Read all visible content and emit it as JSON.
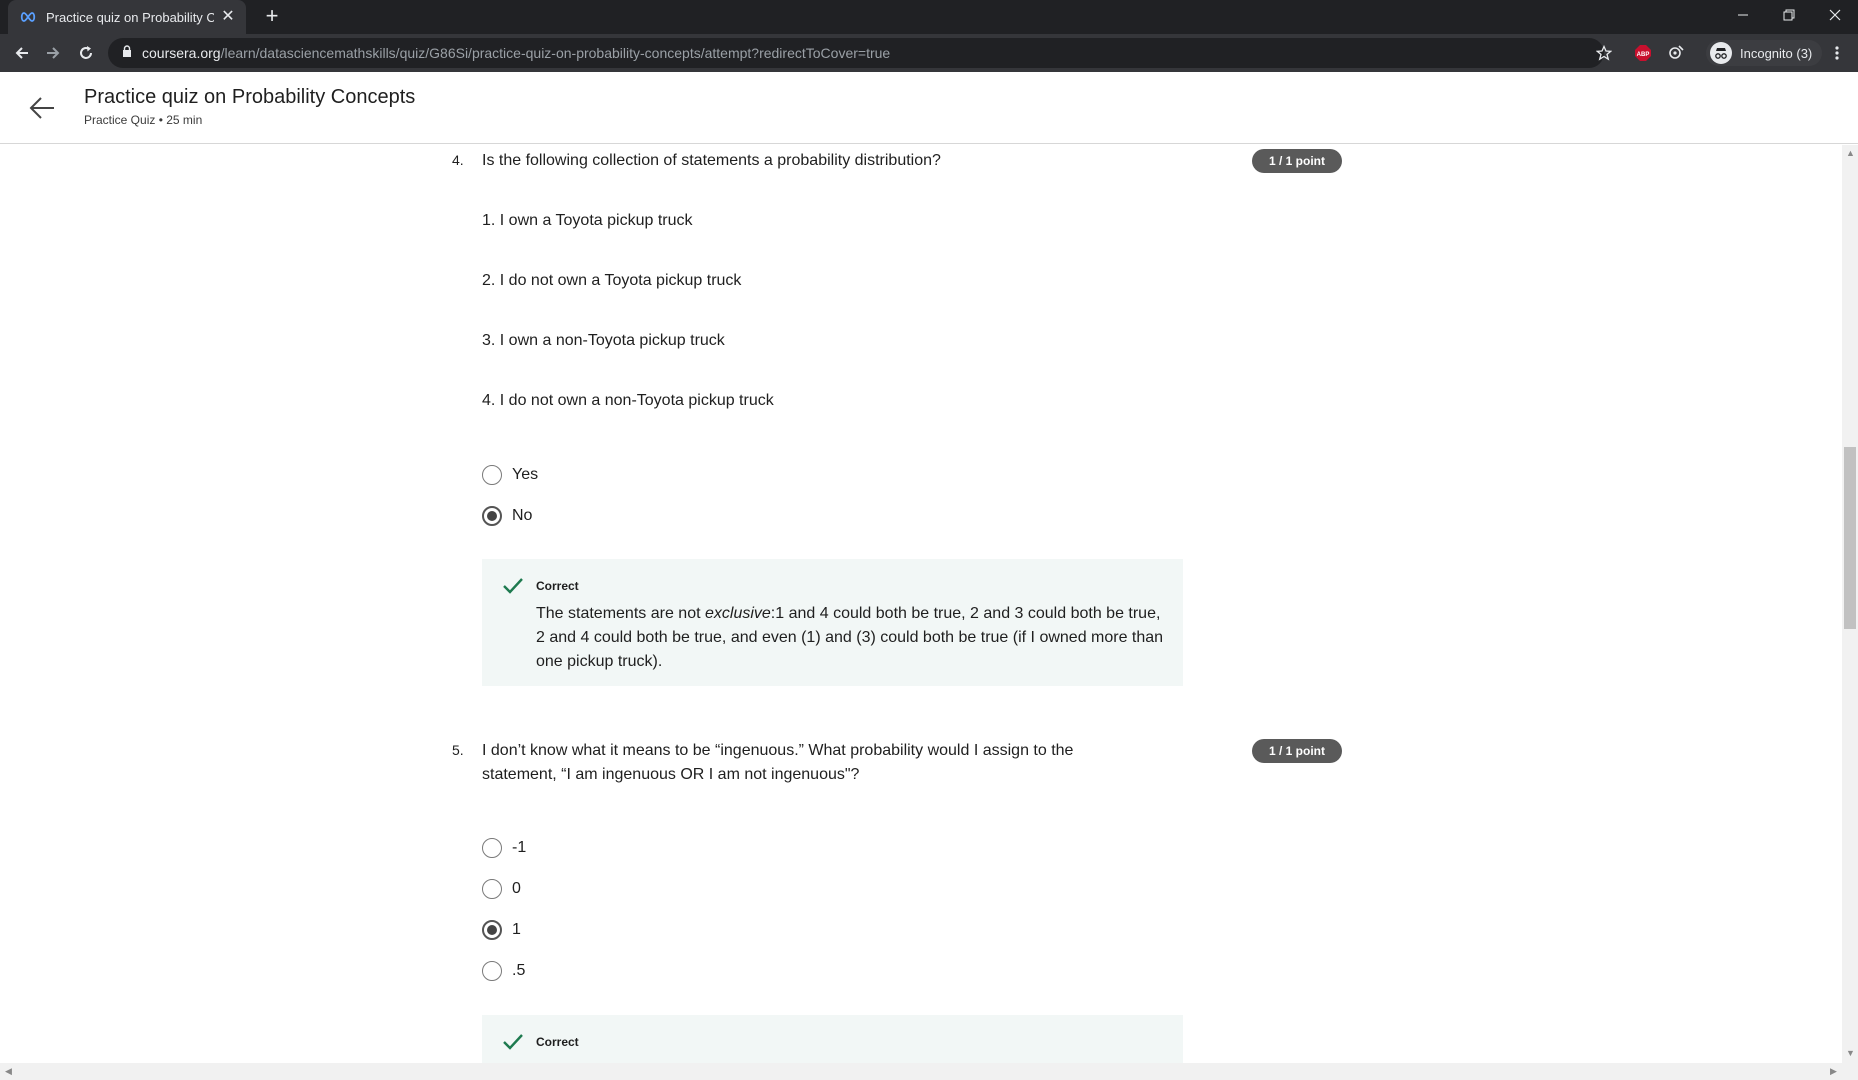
{
  "browser": {
    "tab_title": "Practice quiz on Probability Concepts",
    "tab_favicon": "coursera-infinity-icon",
    "new_tab": "+",
    "url_host": "coursera.org",
    "url_path": "/learn/datasciencemathskills/quiz/G86Si/practice-quiz-on-probability-concepts/attempt?redirectToCover=true",
    "profile_label": "Incognito (3)",
    "extension_abp": "ABP"
  },
  "header": {
    "title": "Practice quiz on Probability Concepts",
    "subtitle": "Practice Quiz • 25 min"
  },
  "questions": [
    {
      "number": "4.",
      "text": "Is the following collection of statements a probability distribution?",
      "points": "1 / 1 point",
      "statements": [
        "1. I own a Toyota pickup truck",
        "2. I do not own a Toyota pickup truck",
        "3. I own a non-Toyota pickup truck",
        "4. I do not own a non-Toyota pickup truck"
      ],
      "options": [
        {
          "label": "Yes",
          "selected": false
        },
        {
          "label": "No",
          "selected": true
        }
      ],
      "feedback": {
        "title": "Correct",
        "text_before": "The statements are not ",
        "text_em": "exclusive",
        "text_after": ":1 and 4 could both be true, 2 and 3 could both be true, 2 and 4 could both be true, and even (1) and (3) could both be true (if I owned more than one pickup truck)."
      }
    },
    {
      "number": "5.",
      "text": "I don’t know what it means to be “ingenuous.” What probability would I assign to the statement, “I am ingenuous OR I am not ingenuous\"?",
      "points": "1 / 1 point",
      "options": [
        {
          "label": "-1",
          "selected": false
        },
        {
          "label": "0",
          "selected": false
        },
        {
          "label": "1",
          "selected": true
        },
        {
          "label": ".5",
          "selected": false
        }
      ],
      "feedback": {
        "title": "Correct"
      }
    }
  ],
  "colors": {
    "chrome_dark": "#202124",
    "chrome_tab": "#35363a",
    "badge": "#5a5a5a",
    "feedback_bg": "#f2f7f6",
    "correct_green": "#1e7a4f"
  }
}
